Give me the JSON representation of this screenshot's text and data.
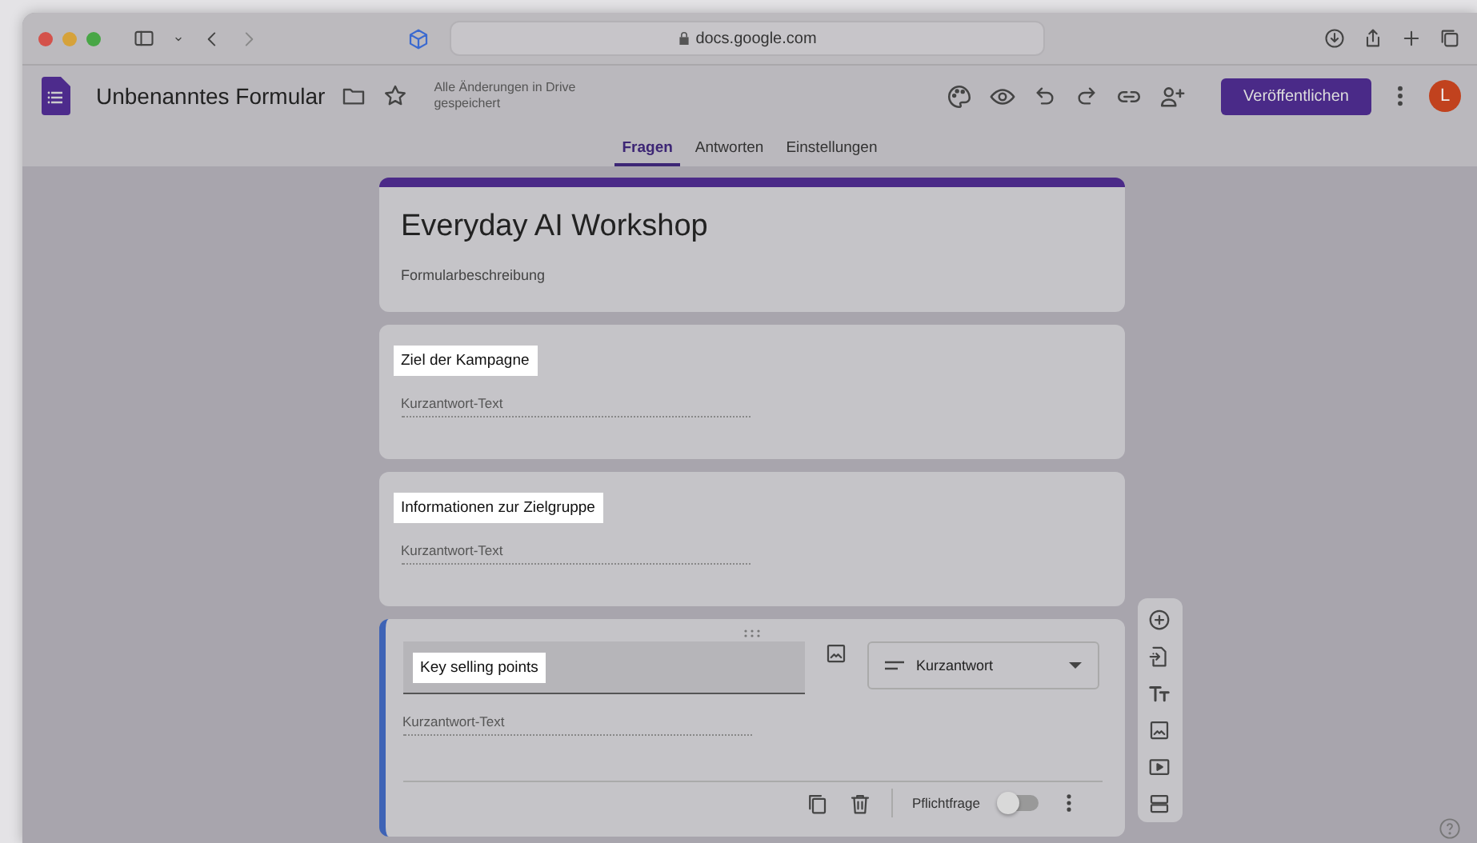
{
  "browser": {
    "url": "docs.google.com"
  },
  "app": {
    "title": "Unbenanntes Formular",
    "save_status": "Alle Änderungen in Drive gespeichert",
    "publish_button": "Veröffentlichen",
    "avatar": "L"
  },
  "tabs": [
    {
      "label": "Fragen",
      "selected": true
    },
    {
      "label": "Antworten",
      "selected": false
    },
    {
      "label": "Einstellungen",
      "selected": false
    }
  ],
  "form": {
    "title": "Everyday AI Workshop",
    "description": "Formularbeschreibung"
  },
  "questions": [
    {
      "title": "Ziel der Kampagne",
      "placeholder": "Kurzantwort-Text",
      "selected": false
    },
    {
      "title": "Informationen zur Zielgruppe",
      "placeholder": "Kurzantwort-Text",
      "selected": false
    },
    {
      "title": "Key selling points",
      "placeholder": "Kurzantwort-Text",
      "selected": true,
      "type": "Kurzantwort",
      "required_label": "Pflichtfrage",
      "required": false
    }
  ]
}
